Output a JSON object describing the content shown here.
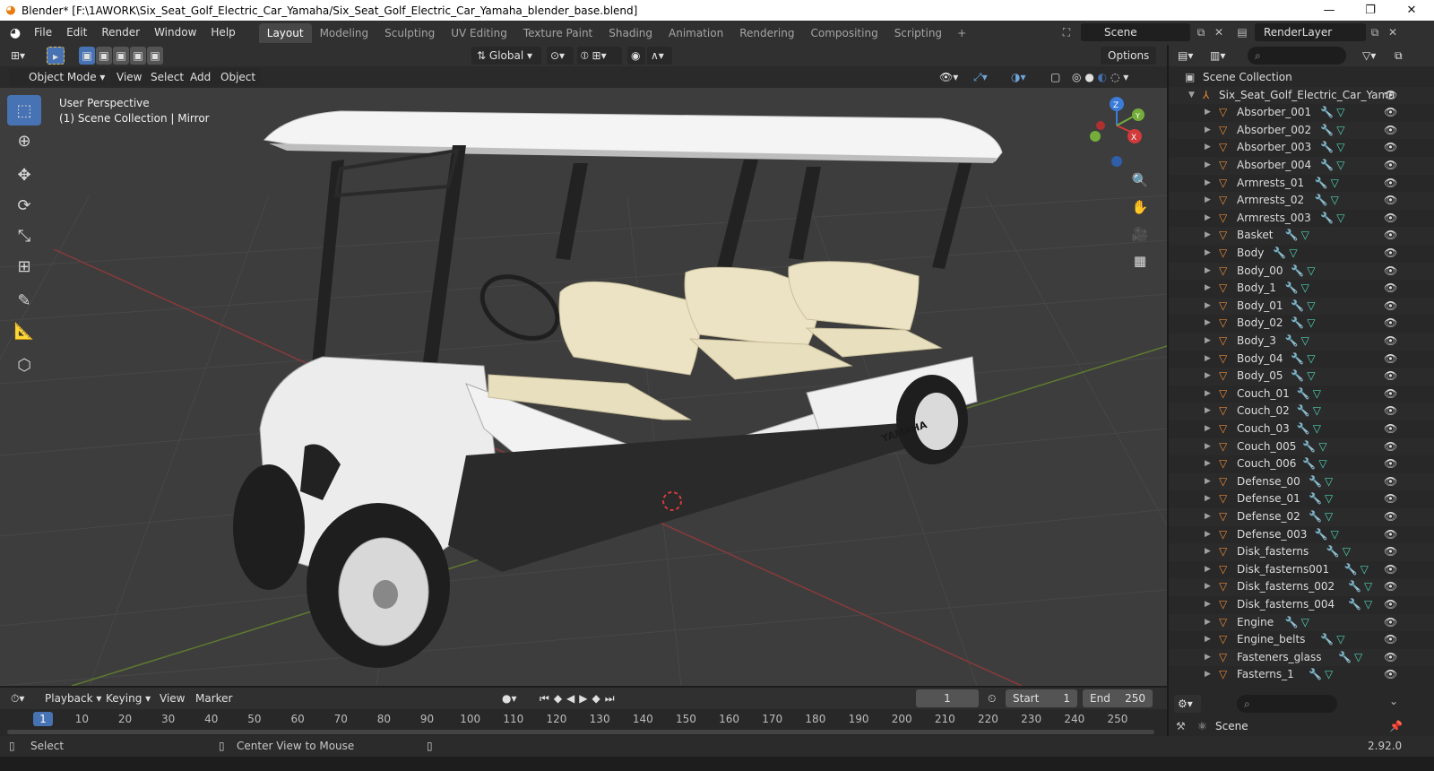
{
  "window": {
    "title": "Blender* [F:\\1AWORK\\Six_Seat_Golf_Electric_Car_Yamaha/Six_Seat_Golf_Electric_Car_Yamaha_blender_base.blend]",
    "controls": {
      "minimize": "—",
      "maximize": "❐",
      "close": "✕"
    }
  },
  "menubar": {
    "items": [
      "File",
      "Edit",
      "Render",
      "Window",
      "Help"
    ],
    "workspaces": [
      "Layout",
      "Modeling",
      "Sculpting",
      "UV Editing",
      "Texture Paint",
      "Shading",
      "Animation",
      "Rendering",
      "Compositing",
      "Scripting"
    ],
    "active_workspace": "Layout",
    "add_tab": "+",
    "scene": "Scene",
    "view_layer": "RenderLayer"
  },
  "viewport_header": {
    "orientation": "Global",
    "options": "Options"
  },
  "viewport_header2": {
    "mode": "Object Mode",
    "menus": [
      "View",
      "Select",
      "Add",
      "Object"
    ]
  },
  "viewport": {
    "perspective_label": "User Perspective",
    "collection_label": "(1) Scene Collection | Mirror",
    "brand_text": "YAMAHA",
    "axis_labels": {
      "x": "X",
      "y": "Y",
      "z": "Z"
    }
  },
  "outliner": {
    "search_placeholder": "",
    "root": "Scene Collection",
    "collection": "Six_Seat_Golf_Electric_Car_Yama",
    "objects": [
      "Absorber_001",
      "Absorber_002",
      "Absorber_003",
      "Absorber_004",
      "Armrests_01",
      "Armrests_02",
      "Armrests_003",
      "Basket",
      "Body",
      "Body_00",
      "Body_1",
      "Body_01",
      "Body_02",
      "Body_3",
      "Body_04",
      "Body_05",
      "Couch_01",
      "Couch_02",
      "Couch_03",
      "Couch_005",
      "Couch_006",
      "Defense_00",
      "Defense_01",
      "Defense_02",
      "Defense_003",
      "Disk_fasterns",
      "Disk_fasterns001",
      "Disk_fasterns_002",
      "Disk_fasterns_004",
      "Engine",
      "Engine_belts",
      "Fasteners_glass",
      "Fasterns_1"
    ]
  },
  "timeline": {
    "menus": [
      "Playback",
      "Keying",
      "View",
      "Marker"
    ],
    "current_frame": "1",
    "start_label": "Start",
    "start": "1",
    "end_label": "End",
    "end": "250",
    "ticks": [
      "1",
      "10",
      "20",
      "30",
      "40",
      "50",
      "60",
      "70",
      "80",
      "90",
      "100",
      "110",
      "120",
      "130",
      "140",
      "150",
      "160",
      "170",
      "180",
      "190",
      "200",
      "210",
      "220",
      "230",
      "240",
      "250"
    ]
  },
  "properties": {
    "scene": "Scene"
  },
  "statusbar": {
    "select": "Select",
    "center_view": "Center View to Mouse",
    "version": "2.92.0"
  },
  "colors": {
    "accent": "#4772b3",
    "object_orange": "#e6893a",
    "modifier_blue": "#6fa5d9",
    "mesh_teal": "#4fd3b4",
    "viewport_bg": "#3d3d3d"
  }
}
